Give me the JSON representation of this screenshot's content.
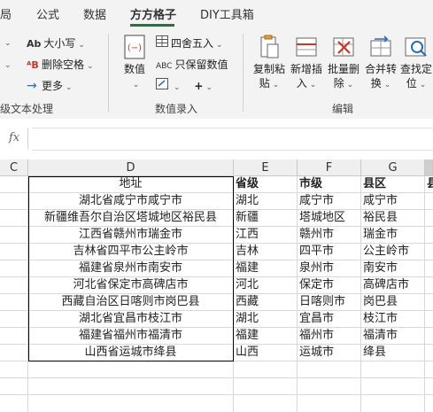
{
  "tabs": [
    "局",
    "公式",
    "数据",
    "方方格子",
    "DIY工具箱"
  ],
  "active_tab_index": 3,
  "ribbon": {
    "text_group": {
      "items": [
        {
          "icon": "Ab",
          "label": "大小写"
        },
        {
          "icon": "ᴬB",
          "label": "删除空格"
        },
        {
          "icon": "→",
          "label": "更多"
        }
      ],
      "group_label": "级文本处理"
    },
    "entry_group": {
      "value_button": "数值",
      "items": [
        {
          "label": "四舍五入"
        },
        {
          "icon": "ABC",
          "label": "只保留数值"
        },
        {
          "icon": "+",
          "label": ""
        }
      ],
      "group_label": "数值录入"
    },
    "edit_group": {
      "buttons": [
        {
          "line1": "复制粘",
          "line2": "贴"
        },
        {
          "line1": "新增插",
          "line2": "入"
        },
        {
          "line1": "批量删",
          "line2": "除"
        },
        {
          "line1": "合并转",
          "line2": "换"
        },
        {
          "line1": "查找定",
          "line2": "位"
        }
      ],
      "group_label": "编辑"
    }
  },
  "formula_bar": {
    "fx_label": "fx",
    "value": ""
  },
  "columns": [
    "C",
    "D",
    "E",
    "F",
    "G",
    ""
  ],
  "header_row": {
    "address": "地址",
    "province": "省级",
    "city": "市级",
    "county": "县区",
    "extra": "县"
  },
  "rows": [
    {
      "address": "湖北省咸宁市咸宁市",
      "province": "湖北",
      "city": "咸宁市",
      "county": "咸宁市"
    },
    {
      "address": "新疆维吾尔自治区塔城地区裕民县",
      "province": "新疆",
      "city": "塔城地区",
      "county": "裕民县"
    },
    {
      "address": "江西省赣州市瑞金市",
      "province": "江西",
      "city": "赣州市",
      "county": "瑞金市"
    },
    {
      "address": "吉林省四平市公主岭市",
      "province": "吉林",
      "city": "四平市",
      "county": "公主岭市"
    },
    {
      "address": "福建省泉州市南安市",
      "province": "福建",
      "city": "泉州市",
      "county": "南安市"
    },
    {
      "address": "河北省保定市高碑店市",
      "province": "河北",
      "city": "保定市",
      "county": "高碑店市"
    },
    {
      "address": "西藏自治区日喀则市岗巴县",
      "province": "西藏",
      "city": "日喀则市",
      "county": "岗巴县"
    },
    {
      "address": "湖北省宜昌市枝江市",
      "province": "湖北",
      "city": "宜昌市",
      "county": "枝江市"
    },
    {
      "address": "福建省福州市福清市",
      "province": "福建",
      "city": "福州市",
      "county": "福清市"
    },
    {
      "address": "山西省运城市绛县",
      "province": "山西",
      "city": "运城市",
      "county": "绛县"
    }
  ],
  "colors": {
    "accent": "#217346",
    "header_bg": "#efefef",
    "ribbon_bg": "#f3f3f3",
    "red_icon": "#c0392b",
    "blue_icon": "#2b6cb0"
  }
}
